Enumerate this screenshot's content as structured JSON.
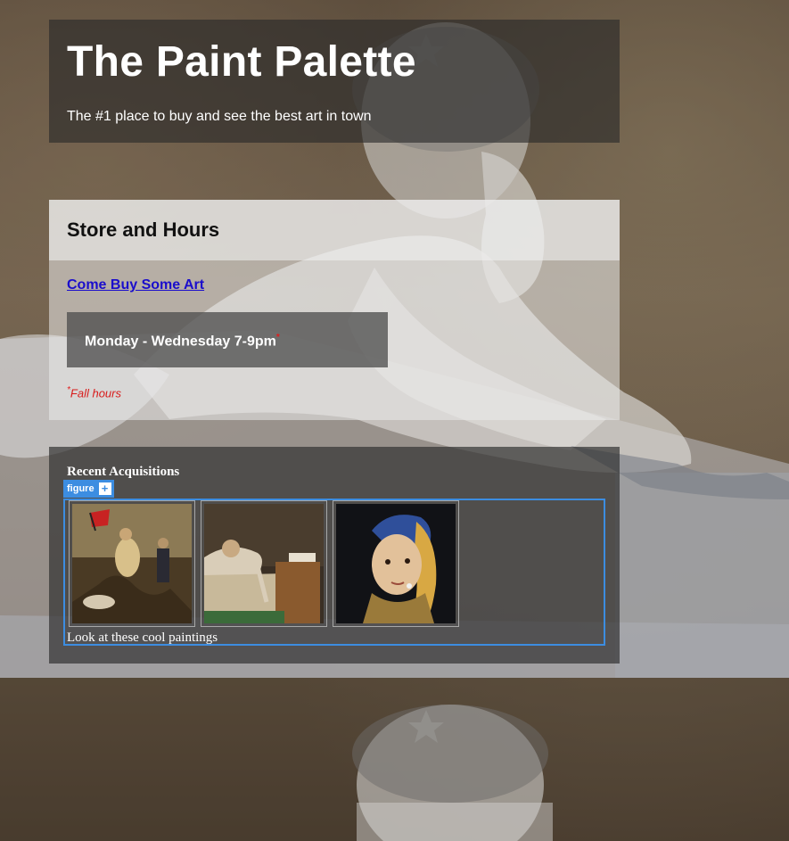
{
  "header": {
    "title": "The Paint Palette",
    "tagline": "The #1 place to buy and see the best art in town"
  },
  "store": {
    "title": "Store and Hours",
    "link_text": "Come Buy Some Art",
    "hours": "Monday - Wednesday 7-9pm",
    "hours_mark": "*",
    "footnote_mark": "*",
    "footnote": "Fall hours"
  },
  "recent": {
    "title": "Recent Acquisitions",
    "figure_tag": "figure",
    "figure_tag_action": "+",
    "caption": "Look at these cool paintings",
    "paintings": [
      {
        "subject": "liberty-leading-the-people"
      },
      {
        "subject": "death-of-marat"
      },
      {
        "subject": "girl-with-a-pearl-earring"
      }
    ]
  },
  "colors": {
    "accent": "#3c8de1",
    "link": "#1a0dcc",
    "footnote": "#d81b1b"
  }
}
